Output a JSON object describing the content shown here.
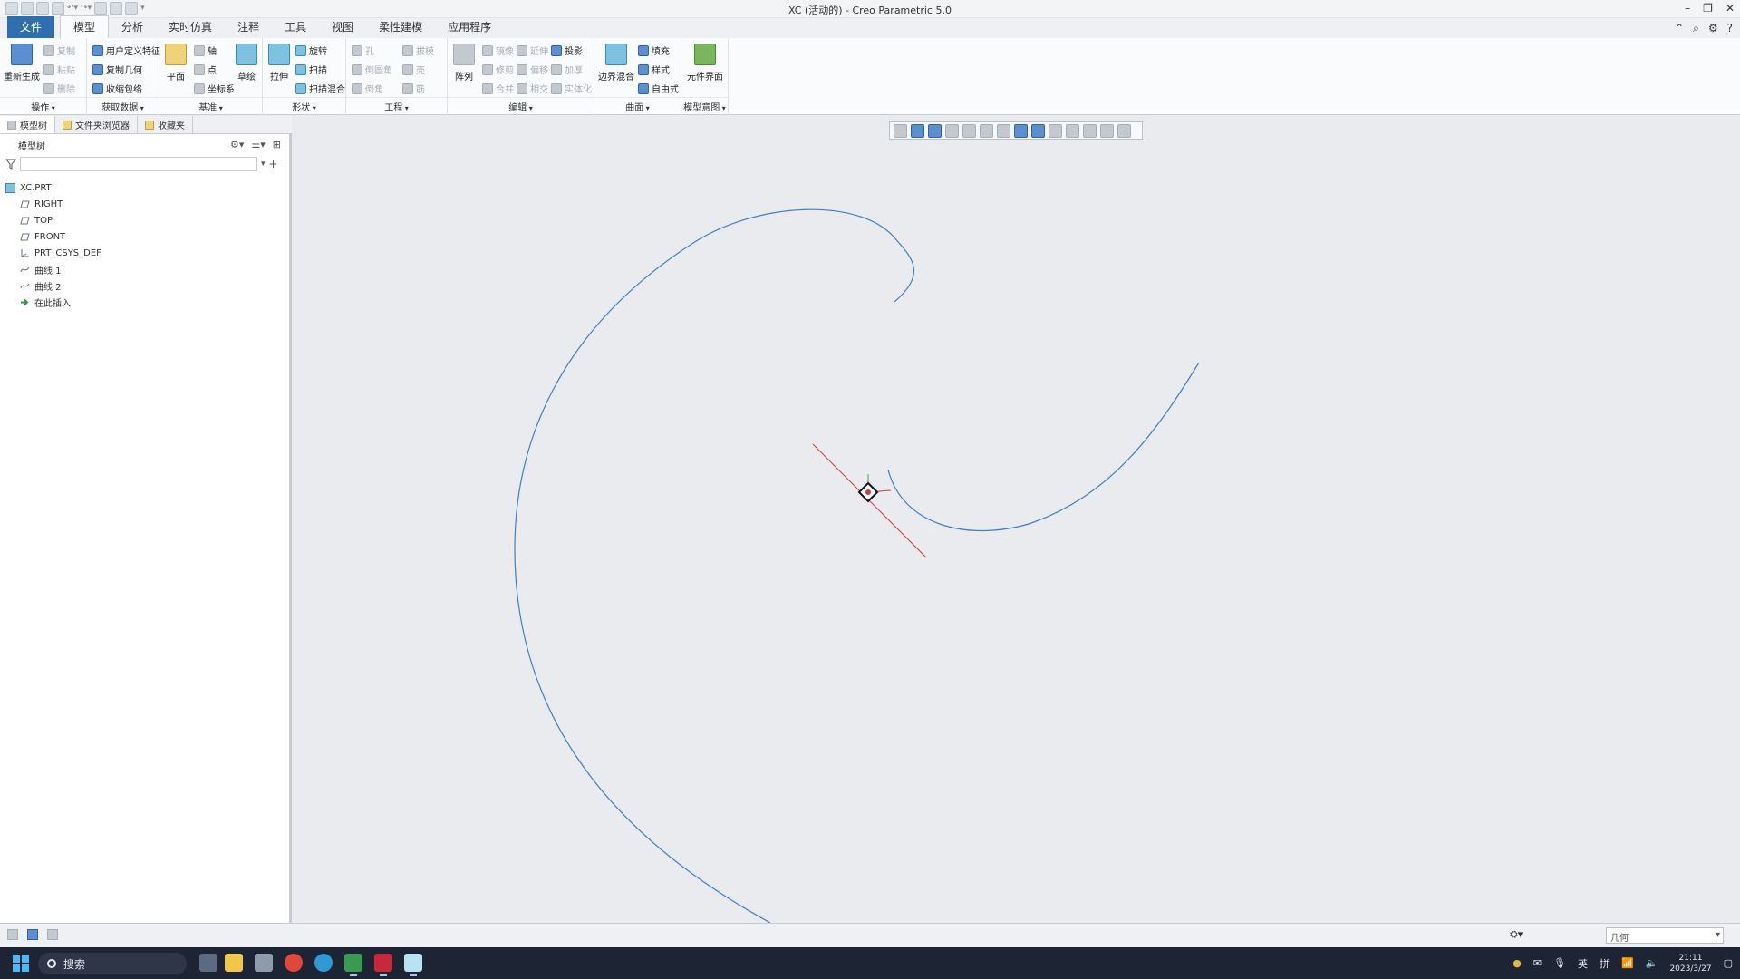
{
  "window": {
    "title": "XC (活动的) - Creo Parametric 5.0"
  },
  "ribbon_tabs": [
    "文件",
    "模型",
    "分析",
    "实时仿真",
    "注释",
    "工具",
    "视图",
    "柔性建模",
    "应用程序"
  ],
  "active_tab": "模型",
  "ribbon": {
    "groups": {
      "operations": {
        "label": "操作",
        "regenerate": "重新生成",
        "copy": "复制",
        "paste": "粘贴",
        "delete": "删除"
      },
      "get_data": {
        "label": "获取数据",
        "udf": "用户定义特征",
        "copy_geom": "复制几何",
        "shrinkwrap": "收缩包络"
      },
      "datum": {
        "label": "基准",
        "plane": "平面",
        "axis": "轴",
        "point": "点",
        "csys": "坐标系",
        "sketch": "草绘"
      },
      "shapes": {
        "label": "形状",
        "extrude": "拉伸",
        "revolve": "旋转",
        "sweep": "扫描",
        "swept_blend": "扫描混合"
      },
      "engineering": {
        "label": "工程",
        "hole": "孔",
        "round": "倒圆角",
        "chamfer": "倒角",
        "draft": "拔模",
        "shell": "壳",
        "rib": "筋"
      },
      "editing": {
        "label": "编辑",
        "pattern": "阵列",
        "mirror": "镜像",
        "trim": "修剪",
        "merge": "合并",
        "extend": "延伸",
        "offset": "偏移",
        "intersect": "相交",
        "project": "投影",
        "thicken": "加厚",
        "solidify": "实体化"
      },
      "surfaces": {
        "label": "曲面",
        "boundary_blend": "边界混合",
        "fill": "填充",
        "style": "样式",
        "freestyle": "自由式"
      },
      "model_intent": {
        "label": "模型意图",
        "component_interface": "元件界面"
      }
    }
  },
  "left_panel": {
    "tabs": [
      "模型树",
      "文件夹浏览器",
      "收藏夹"
    ],
    "tree_header": "模型树",
    "filter_placeholder": "",
    "tree": {
      "root": "XC.PRT",
      "items": [
        {
          "label": "RIGHT",
          "icon": "datum-plane-icon"
        },
        {
          "label": "TOP",
          "icon": "datum-plane-icon"
        },
        {
          "label": "FRONT",
          "icon": "datum-plane-icon"
        },
        {
          "label": "PRT_CSYS_DEF",
          "icon": "csys-icon"
        },
        {
          "label": "曲线 1",
          "icon": "curve-icon"
        },
        {
          "label": "曲线 2",
          "icon": "curve-icon"
        },
        {
          "label": "在此插入",
          "icon": "insert-arrow-icon"
        }
      ]
    }
  },
  "status": {
    "selection_filter": "几何"
  },
  "taskbar": {
    "search_label": "搜索",
    "ime_lang": "英",
    "ime_mode": "拼",
    "time": "21:11",
    "date": "2023/3/27"
  },
  "colors": {
    "curve": "#3f7fc6",
    "accent": "#2f6fb0",
    "axis_red": "#d23b3b",
    "axis_green": "#34b34a"
  }
}
